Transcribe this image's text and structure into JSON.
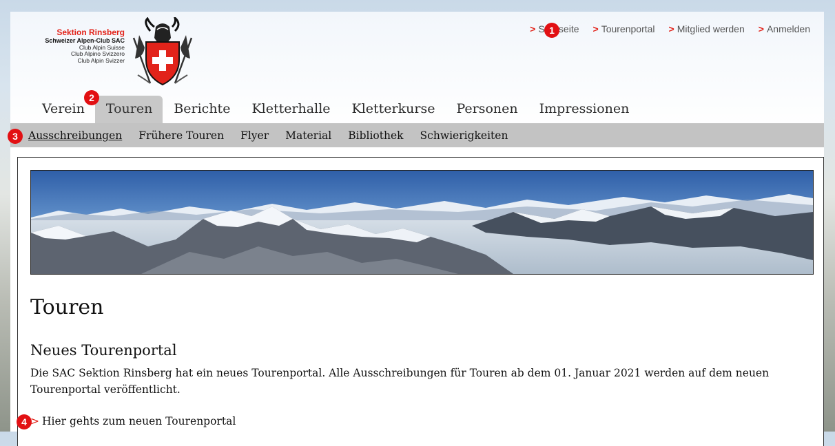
{
  "brand": {
    "section_name": "Sektion Rinsberg",
    "club_name": "Schweizer Alpen-Club SAC",
    "lang_lines": [
      "Club Alpin Suisse",
      "Club Alpino Svizzero",
      "Club Alpin Svizzer"
    ],
    "accent_color": "#e2231a",
    "emblem_icon": "sac-chamois-shield-emblem"
  },
  "topnav": {
    "marker": ">",
    "items": [
      {
        "label": "Startseite"
      },
      {
        "label": "Tourenportal"
      },
      {
        "label": "Mitglied werden"
      },
      {
        "label": "Anmelden"
      }
    ]
  },
  "mainnav": {
    "items": [
      {
        "label": "Verein"
      },
      {
        "label": "Touren",
        "active": true
      },
      {
        "label": "Berichte"
      },
      {
        "label": "Kletterhalle"
      },
      {
        "label": "Kletterkurse"
      },
      {
        "label": "Personen"
      },
      {
        "label": "Impressionen"
      }
    ]
  },
  "subnav": {
    "items": [
      {
        "label": "Ausschreibungen",
        "active": true
      },
      {
        "label": "Frühere Touren"
      },
      {
        "label": "Flyer"
      },
      {
        "label": "Material"
      },
      {
        "label": "Bibliothek"
      },
      {
        "label": "Schwierigkeiten"
      }
    ]
  },
  "annotations": [
    "1",
    "2",
    "3",
    "4"
  ],
  "content": {
    "page_title": "Touren",
    "section_title": "Neues Tourenportal",
    "paragraph": "Die SAC Sektion Rinsberg hat ein neues Tourenportal. Alle Ausschreibungen für Touren ab dem 01. Januar 2021 werden auf dem neuen Tourenportal veröffentlicht.",
    "link_marker": ">",
    "link_label": "Hier gehts zum neuen Tourenportal",
    "banner_icon": "mountain-panorama-image"
  }
}
